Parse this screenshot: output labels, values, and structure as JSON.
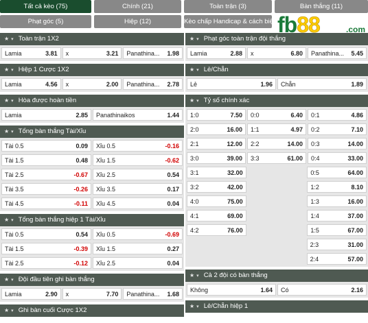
{
  "tabs": [
    {
      "label": "Tất cả kèo (75)",
      "active": true
    },
    {
      "label": "Chính (21)"
    },
    {
      "label": "Toàn trận (3)"
    },
    {
      "label": "Bàn thắng (11)"
    },
    {
      "label": "Phạt góc (5)"
    },
    {
      "label": "Hiệp (12)"
    },
    {
      "label": "Kèo chấp Handicap & cách biệt (2)"
    }
  ],
  "logo": {
    "text_a": "fb",
    "text_b": "88",
    "text_c": ".com"
  },
  "left": {
    "s1": {
      "title": "Toàn trận 1X2",
      "rows": [
        [
          {
            "l": "Lamia",
            "o": "3.81"
          },
          {
            "l": "x",
            "o": "3.21"
          },
          {
            "l": "Panathina...",
            "o": "1.98"
          }
        ]
      ]
    },
    "s2": {
      "title": "Hiệp 1 Cược 1X2",
      "rows": [
        [
          {
            "l": "Lamia",
            "o": "4.56"
          },
          {
            "l": "x",
            "o": "2.00"
          },
          {
            "l": "Panathina...",
            "o": "2.78"
          }
        ]
      ]
    },
    "s3": {
      "title": "Hòa được hoàn tiền",
      "rows": [
        [
          {
            "l": "Lamia",
            "o": "2.85"
          },
          {
            "l": "Panathinaikos",
            "o": "1.44"
          }
        ]
      ]
    },
    "s4": {
      "title": "Tổng bàn thắng Tài/Xỉu",
      "rows": [
        [
          {
            "l": "Tài 0.5",
            "o": "0.09"
          },
          {
            "l": "Xỉu 0.5",
            "o": "-0.16"
          }
        ],
        [
          {
            "l": "Tài 1.5",
            "o": "0.48"
          },
          {
            "l": "Xỉu 1.5",
            "o": "-0.62"
          }
        ],
        [
          {
            "l": "Tài 2.5",
            "o": "-0.67"
          },
          {
            "l": "Xỉu 2.5",
            "o": "0.54"
          }
        ],
        [
          {
            "l": "Tài 3.5",
            "o": "-0.26"
          },
          {
            "l": "Xỉu 3.5",
            "o": "0.17"
          }
        ],
        [
          {
            "l": "Tài 4.5",
            "o": "-0.11"
          },
          {
            "l": "Xỉu 4.5",
            "o": "0.04"
          }
        ]
      ]
    },
    "s5": {
      "title": "Tổng bàn thắng hiệp 1 Tài/Xỉu",
      "rows": [
        [
          {
            "l": "Tài 0.5",
            "o": "0.54"
          },
          {
            "l": "Xỉu 0.5",
            "o": "-0.69"
          }
        ],
        [
          {
            "l": "Tài 1.5",
            "o": "-0.39"
          },
          {
            "l": "Xỉu 1.5",
            "o": "0.27"
          }
        ],
        [
          {
            "l": "Tài 2.5",
            "o": "-0.12"
          },
          {
            "l": "Xỉu 2.5",
            "o": "0.04"
          }
        ]
      ]
    },
    "s6": {
      "title": "Đội đầu tiên ghi bàn thắng",
      "rows": [
        [
          {
            "l": "Lamia",
            "o": "2.90"
          },
          {
            "l": "x",
            "o": "7.70"
          },
          {
            "l": "Panathina...",
            "o": "1.68"
          }
        ]
      ]
    },
    "s7": {
      "title": "Ghi bàn cuối Cược 1X2",
      "rows": []
    }
  },
  "right": {
    "s1": {
      "title": "Phạt góc toàn trận đội thắng",
      "rows": [
        [
          {
            "l": "Lamia",
            "o": "2.88"
          },
          {
            "l": "x",
            "o": "6.80"
          },
          {
            "l": "Panathina...",
            "o": "5.45"
          }
        ]
      ]
    },
    "s2": {
      "title": "Lẻ/Chẵn",
      "rows": [
        [
          {
            "l": "Lẻ",
            "o": "1.96"
          },
          {
            "l": "Chẵn",
            "o": "1.89"
          }
        ]
      ]
    },
    "s3": {
      "title": "Tỷ số chính xác",
      "rows": [
        [
          {
            "l": "1:0",
            "o": "7.50"
          },
          {
            "l": "0:0",
            "o": "6.40"
          },
          {
            "l": "0:1",
            "o": "4.86"
          }
        ],
        [
          {
            "l": "2:0",
            "o": "16.00"
          },
          {
            "l": "1:1",
            "o": "4.97"
          },
          {
            "l": "0:2",
            "o": "7.10"
          }
        ],
        [
          {
            "l": "2:1",
            "o": "12.00"
          },
          {
            "l": "2:2",
            "o": "14.00"
          },
          {
            "l": "0:3",
            "o": "14.00"
          }
        ],
        [
          {
            "l": "3:0",
            "o": "39.00"
          },
          {
            "l": "3:3",
            "o": "61.00"
          },
          {
            "l": "0:4",
            "o": "33.00"
          }
        ],
        [
          {
            "l": "3:1",
            "o": "32.00"
          },
          null,
          {
            "l": "0:5",
            "o": "64.00"
          }
        ],
        [
          {
            "l": "3:2",
            "o": "42.00"
          },
          null,
          {
            "l": "1:2",
            "o": "8.10"
          }
        ],
        [
          {
            "l": "4:0",
            "o": "75.00"
          },
          null,
          {
            "l": "1:3",
            "o": "16.00"
          }
        ],
        [
          {
            "l": "4:1",
            "o": "69.00"
          },
          null,
          {
            "l": "1:4",
            "o": "37.00"
          }
        ],
        [
          {
            "l": "4:2",
            "o": "76.00"
          },
          null,
          {
            "l": "1:5",
            "o": "67.00"
          }
        ],
        [
          null,
          null,
          {
            "l": "2:3",
            "o": "31.00"
          }
        ],
        [
          null,
          null,
          {
            "l": "2:4",
            "o": "57.00"
          }
        ]
      ]
    },
    "s4": {
      "title": "Cả 2 đội có bàn thắng",
      "rows": [
        [
          {
            "l": "Không",
            "o": "1.64"
          },
          {
            "l": "Có",
            "o": "2.16"
          }
        ]
      ]
    },
    "s5": {
      "title": "Lẻ/Chẵn hiệp 1",
      "rows": []
    }
  },
  "colors": {
    "header_bg": "#4f5a52",
    "tab_active": "#1a4d2e",
    "tab_bg": "#888888",
    "negative": "#d10000"
  }
}
